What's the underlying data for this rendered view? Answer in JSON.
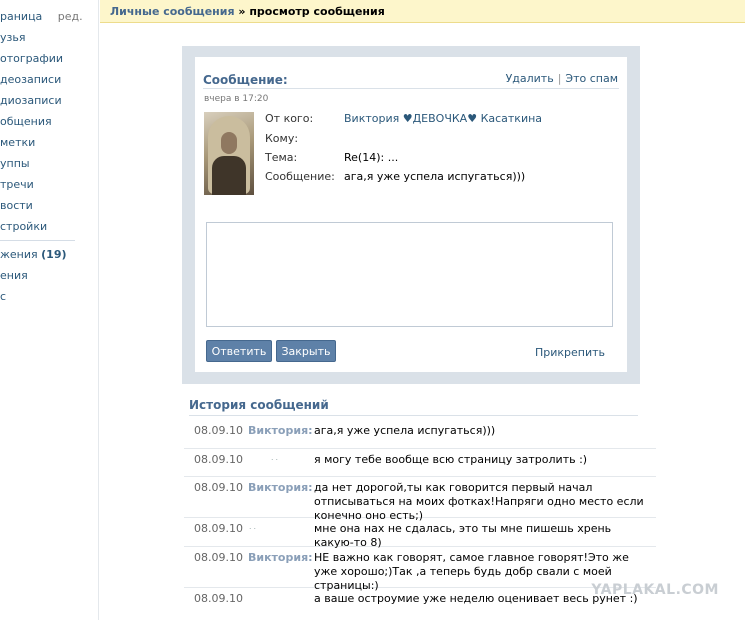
{
  "sidebar": {
    "items": [
      {
        "label": "раница",
        "edit": "ред."
      },
      {
        "label": "узья"
      },
      {
        "label": "отографии"
      },
      {
        "label": "деозаписи"
      },
      {
        "label": "диозаписи"
      },
      {
        "label": "общения"
      },
      {
        "label": "метки"
      },
      {
        "label": "уппы"
      },
      {
        "label": "тречи"
      },
      {
        "label": "вости"
      },
      {
        "label": "стройки"
      },
      {
        "label": "жения",
        "count": "(19)"
      },
      {
        "label": "ения"
      },
      {
        "label": "с"
      }
    ]
  },
  "breadcrumb": {
    "link": "Личные сообщения",
    "separator": " » ",
    "current": "просмотр сообщения"
  },
  "message": {
    "title": "Сообщение:",
    "date": "вчера в 17:20",
    "delete_label": "Удалить",
    "actions_separator": "|",
    "spam_label": "Это спам",
    "from_label": "От кого:",
    "from_value": "Виктория ♥ДЕВОЧКА♥ Касаткина",
    "to_label": "Кому:",
    "to_value": "",
    "subject_label": "Тема:",
    "subject_value": "Re(14): ...",
    "body_label": "Сообщение:",
    "body_value": "ага,я уже успела испугаться)))",
    "reply_value": "",
    "reply_button": "Ответить",
    "close_button": "Закрыть",
    "attach_label": "Прикрепить"
  },
  "history": {
    "title": "История сообщений",
    "rows": [
      {
        "date": "08.09.10",
        "name": "Виктория:",
        "text": "ага,я уже успела испугаться)))"
      },
      {
        "date": "08.09.10",
        "name": "",
        "text": "я могу тебе вообще всю страницу затролить :)"
      },
      {
        "date": "08.09.10",
        "name": "Виктория:",
        "text": "да нет дорогой,ты как говорится первый начал отписываться на моих фотках!Напряги одно место если конечно оно есть;)"
      },
      {
        "date": "08.09.10",
        "name": "",
        "text": "мне она нах не сдалась, это ты мне пишешь хрень какую-то 8)"
      },
      {
        "date": "08.09.10",
        "name": "Виктория:",
        "text": "НЕ важно как говорят, самое главное говорят!Это же уже хорошо;)Так ,а теперь будь добр свали с моей страницы:)"
      },
      {
        "date": "08.09.10",
        "name": "",
        "text": "а ваше остроумие уже неделю оценивает весь рунет :)"
      }
    ]
  },
  "watermark": "YAPLAKAL.COM"
}
